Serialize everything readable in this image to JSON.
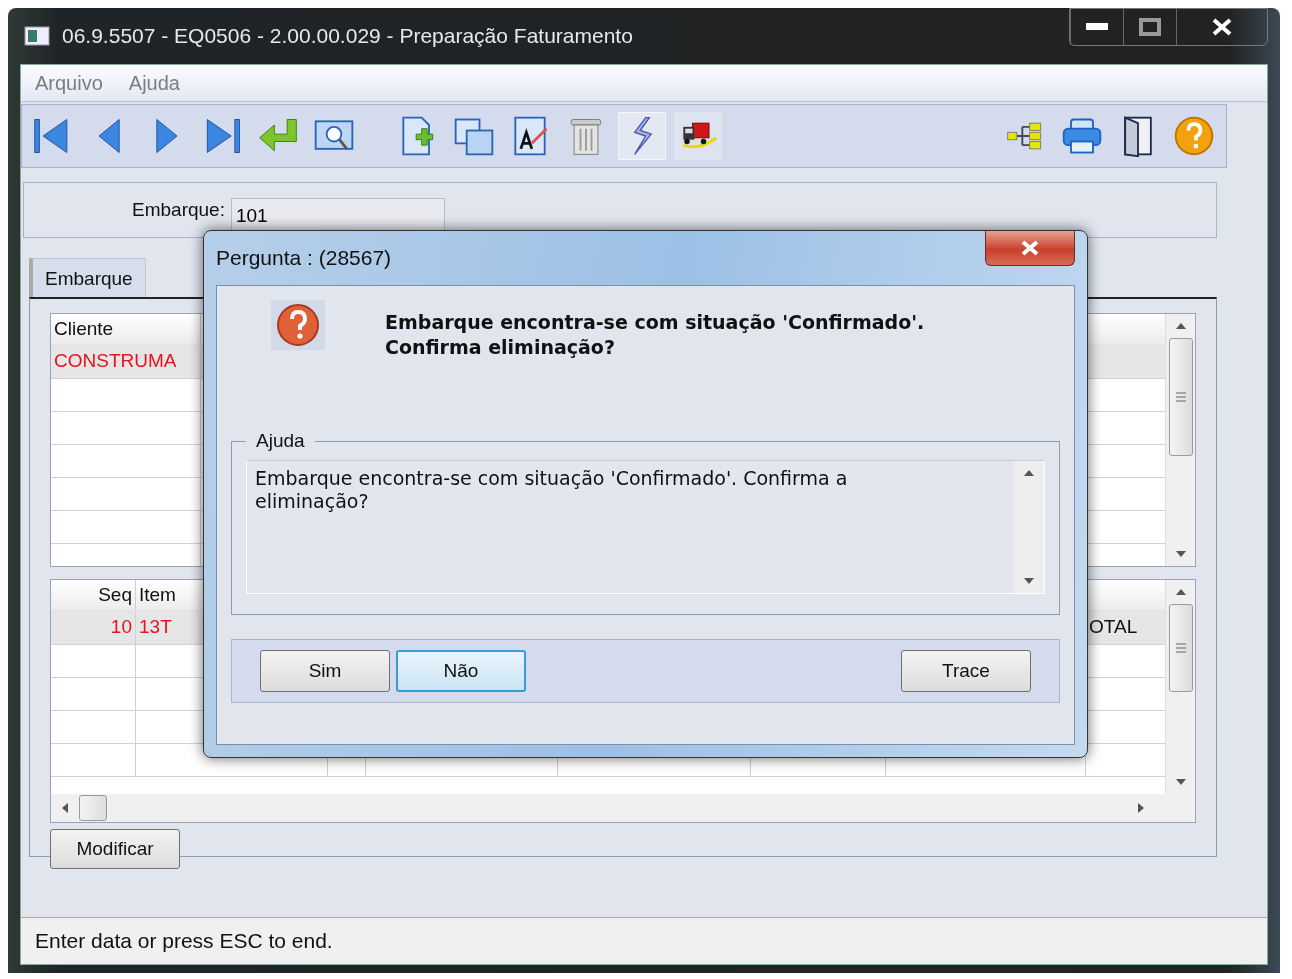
{
  "window": {
    "title": "06.9.5507 - EQ0506 - 2.00.00.029 - Preparação Faturamento"
  },
  "menu": [
    "Arquivo",
    "Ajuda"
  ],
  "embarque_field": {
    "label": "Embarque:",
    "value": "101"
  },
  "tabs": [
    {
      "label": "Embarque",
      "selected": true
    }
  ],
  "grid_top": {
    "columns": [
      "Cliente"
    ],
    "rows": [
      [
        "CONSTRUMA"
      ]
    ]
  },
  "grid_bottom": {
    "columns": [
      "Seq",
      "Item"
    ],
    "rows": [
      {
        "seq": "10",
        "item": "13T",
        "last": "OTAL"
      }
    ]
  },
  "buttons": [
    "Modificar"
  ],
  "status_bar": "Enter data or press ESC to end.",
  "dialog": {
    "title": "Pergunta : (28567)",
    "message": [
      "Embarque encontra-se com situação 'Confirmado'.",
      "Confirma eliminação?"
    ],
    "help_title": "Ajuda",
    "help_text": "Embarque encontra-se com situação 'Confirmado'. Confirma a eliminação?",
    "buttons": [
      {
        "label": "Sim",
        "focused": false
      },
      {
        "label": "Não",
        "focused": true
      },
      {
        "label": "Trace",
        "focused": false
      }
    ]
  }
}
